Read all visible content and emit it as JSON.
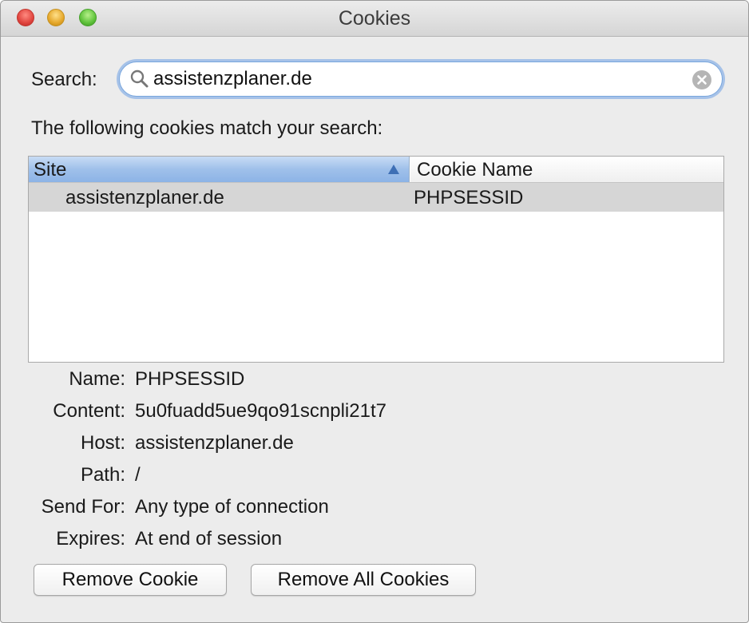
{
  "window": {
    "title": "Cookies"
  },
  "search": {
    "label": "Search:",
    "value": "assistenzplaner.de",
    "placeholder": ""
  },
  "match_text": "The following cookies match your search:",
  "table": {
    "columns": [
      {
        "label": "Site",
        "sorted": "ascending"
      },
      {
        "label": "Cookie Name"
      }
    ],
    "rows": [
      {
        "site": "assistenzplaner.de",
        "cookie_name": "PHPSESSID",
        "selected": true
      }
    ]
  },
  "details": {
    "name": {
      "label": "Name:",
      "value": "PHPSESSID"
    },
    "content": {
      "label": "Content:",
      "value": "5u0fuadd5ue9qo91scnpli21t7"
    },
    "host": {
      "label": "Host:",
      "value": "assistenzplaner.de"
    },
    "path": {
      "label": "Path:",
      "value": "/"
    },
    "send_for": {
      "label": "Send For:",
      "value": "Any type of connection"
    },
    "expires": {
      "label": "Expires:",
      "value": "At end of session"
    }
  },
  "buttons": {
    "remove_cookie": "Remove Cookie",
    "remove_all": "Remove All Cookies"
  },
  "icons": {
    "search": "magnifier-icon",
    "clear": "clear-x-icon",
    "sort": "sort-ascending-icon"
  },
  "colors": {
    "focus_ring": "#7aa7dd",
    "header_selected": "#9fc0ea",
    "row_selected": "#d6d6d6",
    "close": "#e0443e",
    "minimize": "#e5a72a",
    "zoom": "#5ec23a"
  }
}
